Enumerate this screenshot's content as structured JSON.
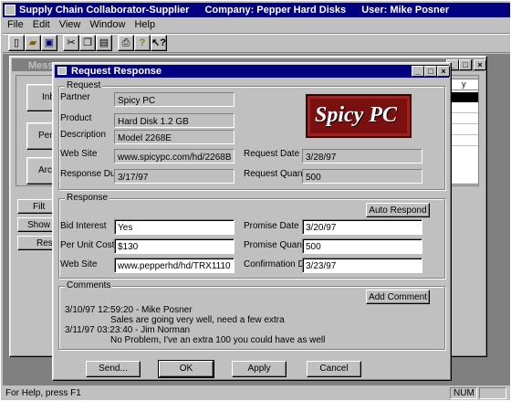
{
  "app": {
    "title": "Supply Chain Collaborator-Supplier",
    "company": "Company: Pepper Hard Disks",
    "user": "User: Mike Posner"
  },
  "menu": [
    "File",
    "Edit",
    "View",
    "Window",
    "Help"
  ],
  "toolbar": {
    "icons": [
      "new-icon",
      "open-icon",
      "save-icon",
      "cut-icon",
      "copy-icon",
      "paste-icon",
      "print-icon",
      "help-icon",
      "context-help-icon"
    ]
  },
  "bg_window": {
    "title": "Messag",
    "tabs": [
      "Inb",
      "Pen",
      "Arc"
    ],
    "buttons": [
      "Filt",
      "Show R",
      "Resp"
    ]
  },
  "dialog": {
    "title": "Request Response",
    "request": {
      "group_label": "Request",
      "partner_label": "Partner",
      "partner": "Spicy PC",
      "product_label": "Product",
      "product": "Hard Disk 1.2 GB",
      "description_label": "Description",
      "description": "Model 2268E",
      "website_label": "Web Site",
      "website": "www.spicypc.com/hd/2268B",
      "request_date_label": "Request Date",
      "request_date": "3/28/97",
      "response_due_label": "Response Due",
      "response_due": "3/17/97",
      "request_qty_label": "Request Quantity",
      "request_qty": "500",
      "logo_text": "Spicy PC"
    },
    "response": {
      "group_label": "Response",
      "auto_respond": "Auto Respond",
      "bid_interest_label": "Bid Interest",
      "bid_interest": "Yes",
      "promise_date_label": "Promise Date",
      "promise_date": "3/20/97",
      "per_unit_label": "Per Unit Cost",
      "per_unit": "$130",
      "promise_qty_label": "Promise Quantity",
      "promise_qty": "500",
      "website_label": "Web Site",
      "website": "www.pepperhd/hd/TRX1110",
      "confirm_due_label": "Confirmation Due",
      "confirm_due": "3/23/97"
    },
    "comments": {
      "group_label": "Comments",
      "add_comment": "Add Comment",
      "lines": [
        "3/10/97 12:59:20 - Mike Posner",
        "Sales are going very well, need a few extra",
        "3/11/97 03:23:40 - Jim Norman",
        "No Problem, I've an extra 100 you could have as well"
      ]
    },
    "buttons": {
      "send": "Send...",
      "ok": "OK",
      "apply": "Apply",
      "cancel": "Cancel"
    }
  },
  "status": {
    "help": "For Help, press F1",
    "num": "NUM"
  }
}
